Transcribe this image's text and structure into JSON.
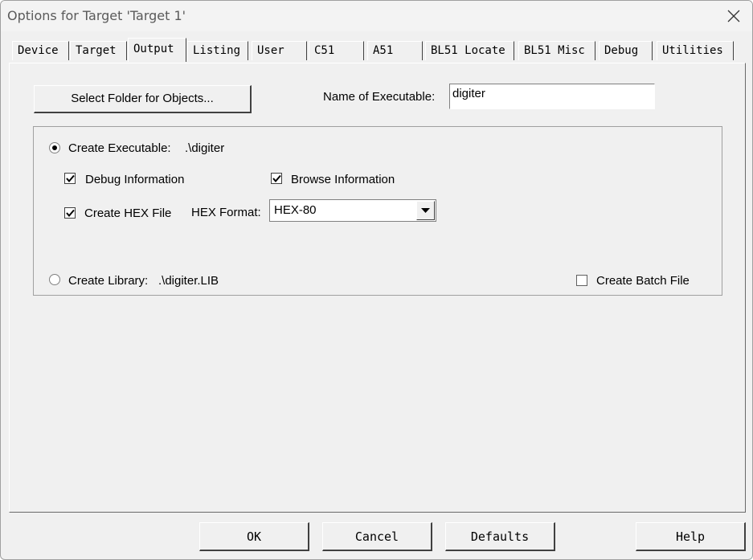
{
  "window": {
    "title": "Options for Target 'Target 1'"
  },
  "tabs": [
    {
      "label": "Device"
    },
    {
      "label": "Target"
    },
    {
      "label": "Output",
      "active": true
    },
    {
      "label": "Listing"
    },
    {
      "label": "User"
    },
    {
      "label": "C51"
    },
    {
      "label": "A51"
    },
    {
      "label": "BL51 Locate"
    },
    {
      "label": "BL51 Misc"
    },
    {
      "label": "Debug"
    },
    {
      "label": "Utilities"
    }
  ],
  "output": {
    "select_folder_label": "Select Folder for Objects...",
    "name_exec_label": "Name of Executable:",
    "name_exec_value": "digiter",
    "create_exec_label": "Create Executable:",
    "create_exec_path": ".\\digiter",
    "create_exec_selected": true,
    "debug_info_label": "Debug Information",
    "debug_info_checked": true,
    "browse_info_label": "Browse Information",
    "browse_info_checked": true,
    "create_hex_label": "Create HEX File",
    "create_hex_checked": true,
    "hex_format_label": "HEX Format:",
    "hex_format_value": "HEX-80",
    "create_lib_label": "Create Library:",
    "create_lib_path": ".\\digiter.LIB",
    "create_lib_selected": false,
    "batch_file_label": "Create Batch File",
    "batch_file_checked": false
  },
  "footer": {
    "ok": "OK",
    "cancel": "Cancel",
    "defaults": "Defaults",
    "help": "Help"
  }
}
